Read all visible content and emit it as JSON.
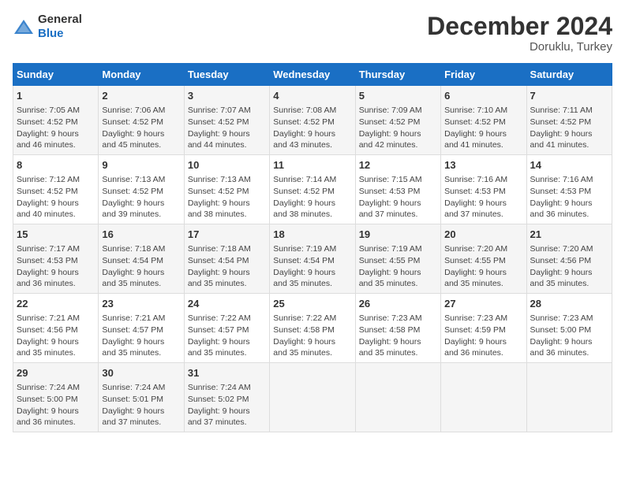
{
  "header": {
    "logo_general": "General",
    "logo_blue": "Blue",
    "title": "December 2024",
    "subtitle": "Doruklu, Turkey"
  },
  "weekdays": [
    "Sunday",
    "Monday",
    "Tuesday",
    "Wednesday",
    "Thursday",
    "Friday",
    "Saturday"
  ],
  "weeks": [
    [
      {
        "day": "1",
        "info": "Sunrise: 7:05 AM\nSunset: 4:52 PM\nDaylight: 9 hours\nand 46 minutes."
      },
      {
        "day": "2",
        "info": "Sunrise: 7:06 AM\nSunset: 4:52 PM\nDaylight: 9 hours\nand 45 minutes."
      },
      {
        "day": "3",
        "info": "Sunrise: 7:07 AM\nSunset: 4:52 PM\nDaylight: 9 hours\nand 44 minutes."
      },
      {
        "day": "4",
        "info": "Sunrise: 7:08 AM\nSunset: 4:52 PM\nDaylight: 9 hours\nand 43 minutes."
      },
      {
        "day": "5",
        "info": "Sunrise: 7:09 AM\nSunset: 4:52 PM\nDaylight: 9 hours\nand 42 minutes."
      },
      {
        "day": "6",
        "info": "Sunrise: 7:10 AM\nSunset: 4:52 PM\nDaylight: 9 hours\nand 41 minutes."
      },
      {
        "day": "7",
        "info": "Sunrise: 7:11 AM\nSunset: 4:52 PM\nDaylight: 9 hours\nand 41 minutes."
      }
    ],
    [
      {
        "day": "8",
        "info": "Sunrise: 7:12 AM\nSunset: 4:52 PM\nDaylight: 9 hours\nand 40 minutes."
      },
      {
        "day": "9",
        "info": "Sunrise: 7:13 AM\nSunset: 4:52 PM\nDaylight: 9 hours\nand 39 minutes."
      },
      {
        "day": "10",
        "info": "Sunrise: 7:13 AM\nSunset: 4:52 PM\nDaylight: 9 hours\nand 38 minutes."
      },
      {
        "day": "11",
        "info": "Sunrise: 7:14 AM\nSunset: 4:52 PM\nDaylight: 9 hours\nand 38 minutes."
      },
      {
        "day": "12",
        "info": "Sunrise: 7:15 AM\nSunset: 4:53 PM\nDaylight: 9 hours\nand 37 minutes."
      },
      {
        "day": "13",
        "info": "Sunrise: 7:16 AM\nSunset: 4:53 PM\nDaylight: 9 hours\nand 37 minutes."
      },
      {
        "day": "14",
        "info": "Sunrise: 7:16 AM\nSunset: 4:53 PM\nDaylight: 9 hours\nand 36 minutes."
      }
    ],
    [
      {
        "day": "15",
        "info": "Sunrise: 7:17 AM\nSunset: 4:53 PM\nDaylight: 9 hours\nand 36 minutes."
      },
      {
        "day": "16",
        "info": "Sunrise: 7:18 AM\nSunset: 4:54 PM\nDaylight: 9 hours\nand 35 minutes."
      },
      {
        "day": "17",
        "info": "Sunrise: 7:18 AM\nSunset: 4:54 PM\nDaylight: 9 hours\nand 35 minutes."
      },
      {
        "day": "18",
        "info": "Sunrise: 7:19 AM\nSunset: 4:54 PM\nDaylight: 9 hours\nand 35 minutes."
      },
      {
        "day": "19",
        "info": "Sunrise: 7:19 AM\nSunset: 4:55 PM\nDaylight: 9 hours\nand 35 minutes."
      },
      {
        "day": "20",
        "info": "Sunrise: 7:20 AM\nSunset: 4:55 PM\nDaylight: 9 hours\nand 35 minutes."
      },
      {
        "day": "21",
        "info": "Sunrise: 7:20 AM\nSunset: 4:56 PM\nDaylight: 9 hours\nand 35 minutes."
      }
    ],
    [
      {
        "day": "22",
        "info": "Sunrise: 7:21 AM\nSunset: 4:56 PM\nDaylight: 9 hours\nand 35 minutes."
      },
      {
        "day": "23",
        "info": "Sunrise: 7:21 AM\nSunset: 4:57 PM\nDaylight: 9 hours\nand 35 minutes."
      },
      {
        "day": "24",
        "info": "Sunrise: 7:22 AM\nSunset: 4:57 PM\nDaylight: 9 hours\nand 35 minutes."
      },
      {
        "day": "25",
        "info": "Sunrise: 7:22 AM\nSunset: 4:58 PM\nDaylight: 9 hours\nand 35 minutes."
      },
      {
        "day": "26",
        "info": "Sunrise: 7:23 AM\nSunset: 4:58 PM\nDaylight: 9 hours\nand 35 minutes."
      },
      {
        "day": "27",
        "info": "Sunrise: 7:23 AM\nSunset: 4:59 PM\nDaylight: 9 hours\nand 36 minutes."
      },
      {
        "day": "28",
        "info": "Sunrise: 7:23 AM\nSunset: 5:00 PM\nDaylight: 9 hours\nand 36 minutes."
      }
    ],
    [
      {
        "day": "29",
        "info": "Sunrise: 7:24 AM\nSunset: 5:00 PM\nDaylight: 9 hours\nand 36 minutes."
      },
      {
        "day": "30",
        "info": "Sunrise: 7:24 AM\nSunset: 5:01 PM\nDaylight: 9 hours\nand 37 minutes."
      },
      {
        "day": "31",
        "info": "Sunrise: 7:24 AM\nSunset: 5:02 PM\nDaylight: 9 hours\nand 37 minutes."
      },
      {
        "day": "",
        "info": ""
      },
      {
        "day": "",
        "info": ""
      },
      {
        "day": "",
        "info": ""
      },
      {
        "day": "",
        "info": ""
      }
    ]
  ]
}
